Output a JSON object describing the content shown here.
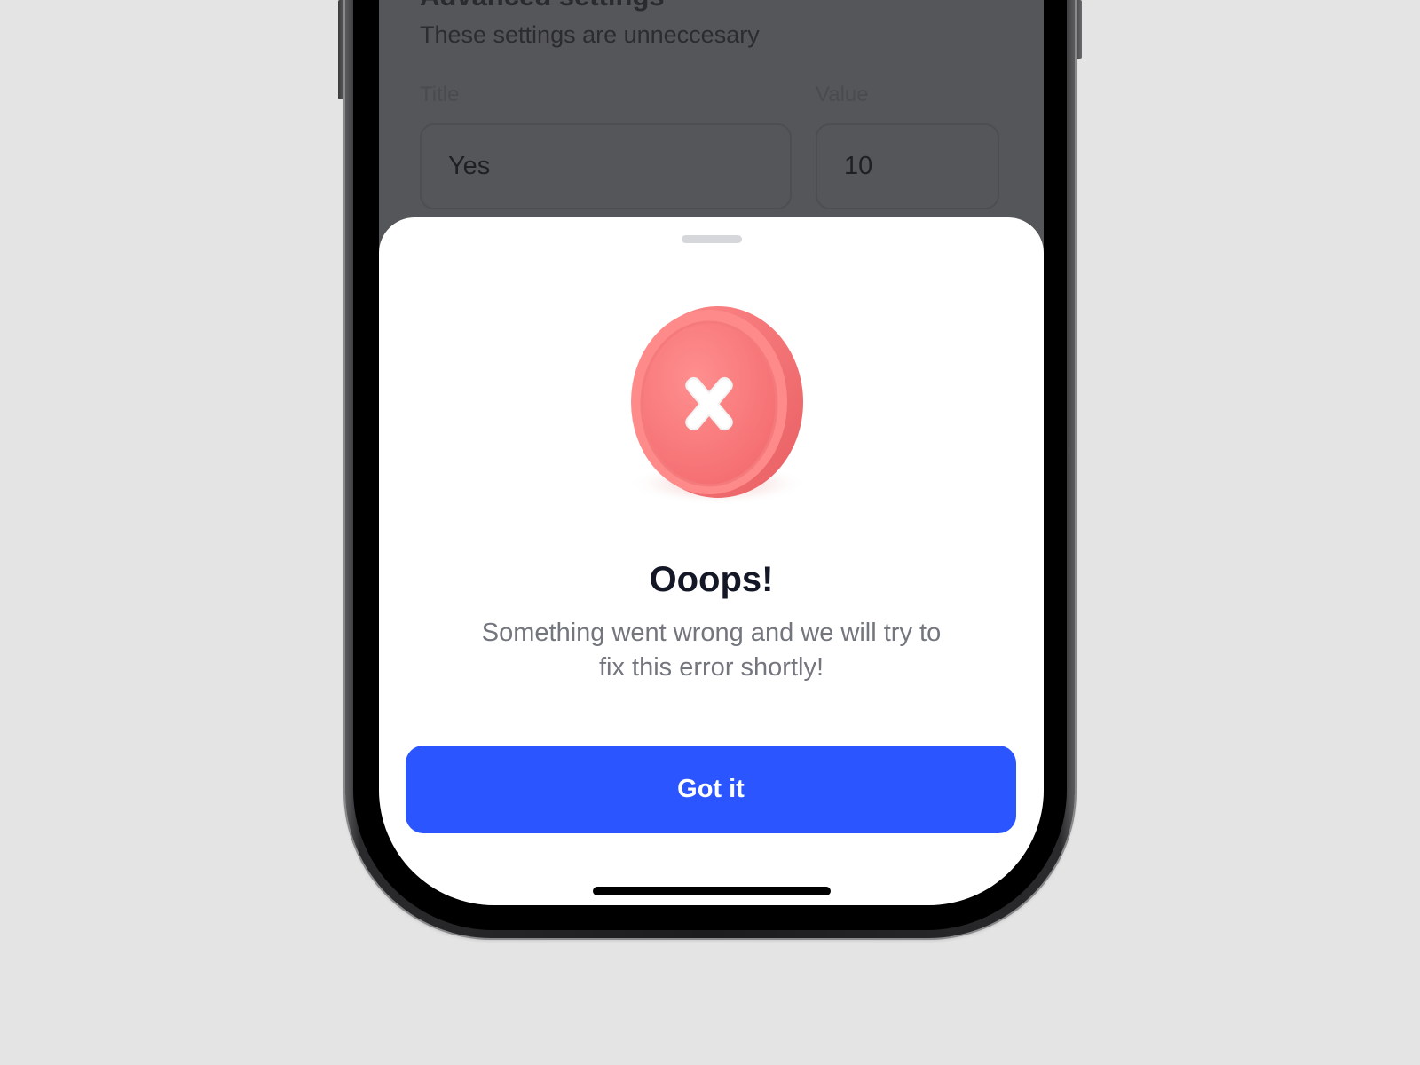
{
  "background_screen": {
    "heading": "Advanced settings",
    "subtitle": "These settings are unneccesary",
    "title_label": "Title",
    "value_label": "Value",
    "title_value": "Yes",
    "value_value": "10"
  },
  "sheet": {
    "title": "Ooops!",
    "message": "Something went wrong and we will try to fix this error shortly!",
    "button_label": "Got it",
    "icon": "error-x-icon"
  },
  "colors": {
    "accent": "#2b56ff",
    "error": "#f87171",
    "overlay": "#55565a",
    "page_background": "#e4e4e4"
  }
}
